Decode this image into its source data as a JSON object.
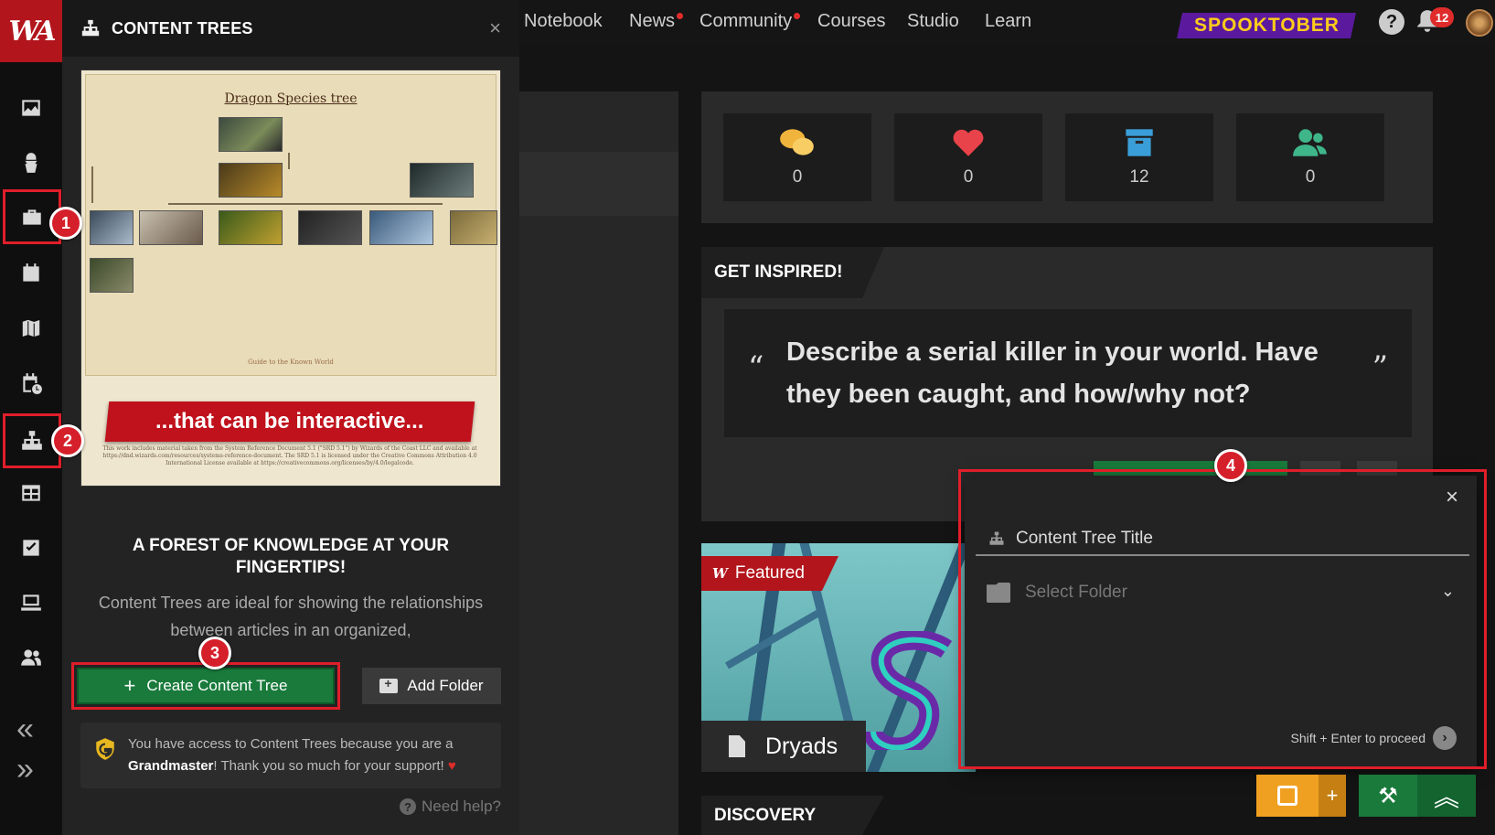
{
  "app": {
    "logo_text": "WA"
  },
  "topbar": {
    "nav": [
      {
        "label": "Notebook",
        "dot": false
      },
      {
        "label": "News",
        "dot": true
      },
      {
        "label": "Community",
        "dot": true
      },
      {
        "label": "Courses",
        "dot": false
      },
      {
        "label": "Studio",
        "dot": false
      },
      {
        "label": "Learn",
        "dot": false
      }
    ],
    "promo": "SPOOKTOBER",
    "help_icon": "?",
    "notification_count": "12"
  },
  "rail": {
    "icons": [
      "image-icon",
      "character-icon",
      "toolbox-icon",
      "calendar-icon",
      "map-icon",
      "timeline-icon",
      "content-tree-icon",
      "table-icon",
      "checklist-icon",
      "laptop-icon",
      "group-icon"
    ],
    "collapse": "«",
    "expand": "»"
  },
  "panel": {
    "title": "CONTENT TREES",
    "close": "×",
    "preview": {
      "chart_title": "Dragon Species tree",
      "guide_text": "Guide to the Known World",
      "banner": "...that can be interactive...",
      "fine_print": "This work includes material taken from the System Reference Document 5.1 (\"SRD 5.1\") by Wizards of the Coast LLC and available at https://dnd.wizards.com/resources/systems-reference-document. The SRD 5.1 is licensed under the Creative Commons Attribution 4.0 International License available at https://creativecommons.org/licenses/by/4.0/legalcode."
    },
    "headline": "A FOREST OF KNOWLEDGE AT YOUR FINGERTIPS!",
    "description": "Content Trees are ideal for showing the relationships between articles in an organized,",
    "create_button": "Create Content Tree",
    "add_folder_button": "Add Folder",
    "notice": {
      "prefix": "You have access to Content Trees because you are a ",
      "rank": "Grandmaster",
      "suffix": "! Thank you so much for your support! "
    },
    "need_help": "Need help?"
  },
  "stats": [
    {
      "icon": "comments-icon",
      "value": "0",
      "color": "#f0b43c"
    },
    {
      "icon": "heart-icon",
      "value": "0",
      "color": "#e8424a"
    },
    {
      "icon": "archive-icon",
      "value": "12",
      "color": "#3a9fd8"
    },
    {
      "icon": "followers-icon",
      "value": "0",
      "color": "#3fb58a"
    }
  ],
  "inspired": {
    "tab": "GET INSPIRED!",
    "quote_open": "“",
    "quote_close": "”",
    "prompt": "Describe a serial killer in your world. Have they been caught, and how/why not?"
  },
  "featured": {
    "tag": "Featured",
    "title": "Dryads"
  },
  "discovery": {
    "tab": "DISCOVERY"
  },
  "modal": {
    "close": "×",
    "title_placeholder": "Content Tree Title",
    "folder_placeholder": "Select Folder",
    "hint": "Shift + Enter to proceed"
  },
  "markers": [
    "1",
    "2",
    "3",
    "4"
  ],
  "colors": {
    "brand_red": "#b3151c",
    "create_green": "#197a3b",
    "annotation_red": "#e01e2a"
  }
}
